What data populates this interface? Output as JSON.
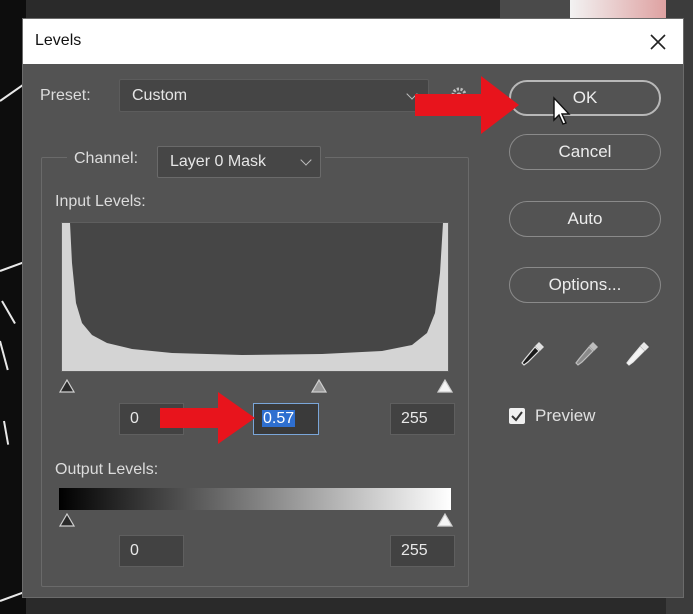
{
  "dialog": {
    "title": "Levels"
  },
  "preset": {
    "label": "Preset:",
    "value": "Custom"
  },
  "channel": {
    "label": "Channel:",
    "value": "Layer 0 Mask"
  },
  "input_levels": {
    "label": "Input Levels:",
    "black": "0",
    "gamma": "0.57",
    "white": "255"
  },
  "output_levels": {
    "label": "Output Levels:",
    "black": "0",
    "white": "255"
  },
  "buttons": {
    "ok": "OK",
    "cancel": "Cancel",
    "auto": "Auto",
    "options": "Options..."
  },
  "preview": {
    "label": "Preview",
    "checked": true
  },
  "icons": {
    "close": "close-icon",
    "gear": "gear-icon",
    "black_eyedropper": "eyedropper-black-icon",
    "gray_eyedropper": "eyedropper-gray-icon",
    "white_eyedropper": "eyedropper-white-icon",
    "annotation_arrow": "red-arrow-icon",
    "cursor": "mouse-cursor-icon"
  },
  "colors": {
    "dialog_bg": "#535353",
    "annotation_arrow": "#e8141c",
    "selection": "#2e6fd0"
  }
}
